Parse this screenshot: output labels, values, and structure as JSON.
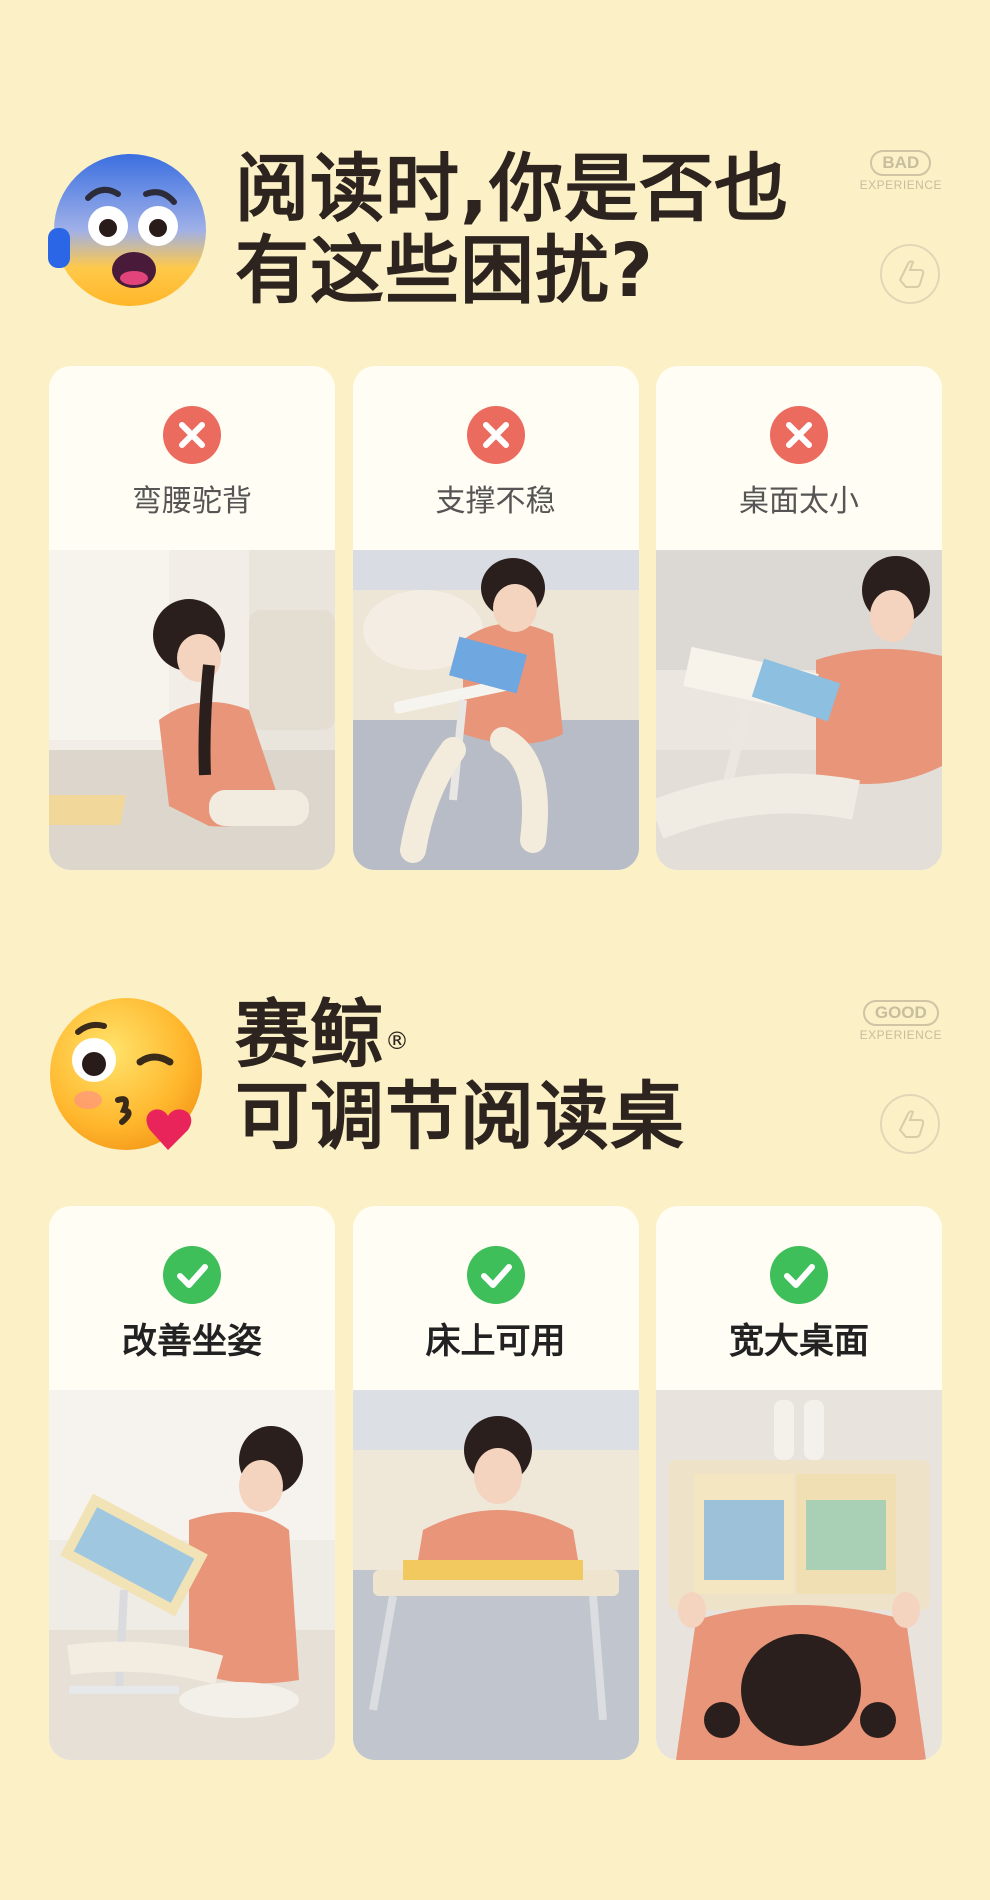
{
  "bad_section": {
    "title_line1": "阅读时,你是否也",
    "title_line2": "有这些困扰?",
    "emoji_icon": "anxious-face-icon",
    "tag_main": "BAD",
    "tag_sub": "EXPERIENCE",
    "tag_icon": "hand-pointer-icon",
    "status_icon": "cross-icon",
    "status_color": "#ec6b5f",
    "items": [
      {
        "label": "弯腰驼背",
        "photo": "child-reading-on-floor-hunched"
      },
      {
        "label": "支撑不稳",
        "photo": "child-reading-with-unstable-stand"
      },
      {
        "label": "桌面太小",
        "photo": "child-reading-on-small-desk"
      }
    ]
  },
  "good_section": {
    "title_line1": "赛鲸",
    "registered_mark": "®",
    "title_line2": "可调节阅读桌",
    "emoji_icon": "kissing-heart-face-icon",
    "tag_main": "GOOD",
    "tag_sub": "EXPERIENCE",
    "tag_icon": "hand-pointer-icon",
    "status_icon": "check-icon",
    "status_color": "#3fbf5a",
    "items": [
      {
        "label": "改善坐姿",
        "photo": "child-upright-with-tilted-desk"
      },
      {
        "label": "床上可用",
        "photo": "child-with-bed-desk"
      },
      {
        "label": "宽大桌面",
        "photo": "top-view-wide-desk"
      }
    ]
  },
  "colors": {
    "background": "#fcf0c6",
    "card": "#fffdf4",
    "title": "#2d2420"
  }
}
